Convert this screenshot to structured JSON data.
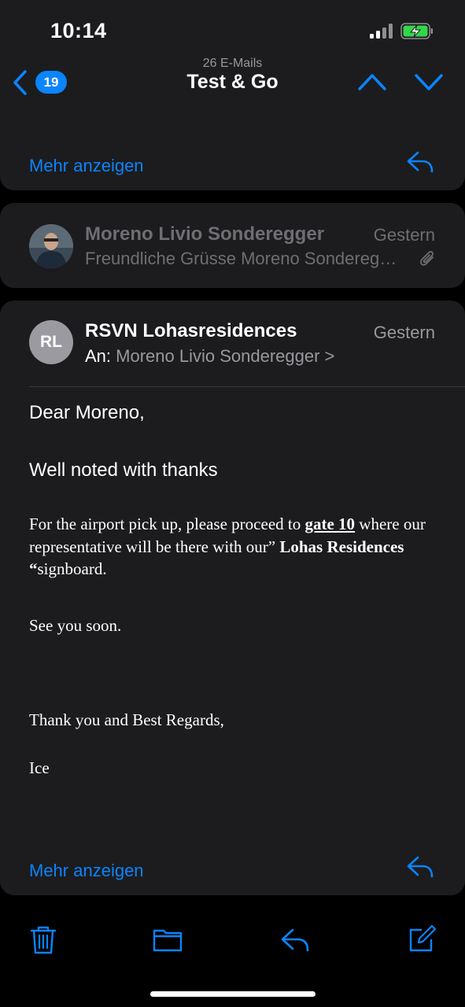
{
  "status_bar": {
    "time": "10:14",
    "signal_bars": 2,
    "signal_total": 4,
    "battery": "charging"
  },
  "nav": {
    "back_count": "19",
    "subtitle": "26 E-Mails",
    "title": "Test & Go",
    "icons": [
      "chevron-left-icon",
      "chevron-up-icon",
      "chevron-down-icon"
    ]
  },
  "first_message": {
    "show_more": "Mehr anzeigen"
  },
  "second_message": {
    "sender": "Moreno Livio Sonderegger",
    "date": "Gestern",
    "preview": "Freundliche Grüsse Moreno Sonderegger",
    "has_attachment": true
  },
  "open_message": {
    "avatar_initials": "RL",
    "sender": "RSVN Lohasresidences",
    "date": "Gestern",
    "to_label": "An:",
    "to_name": "Moreno Livio Sonderegger",
    "to_chevron": ">",
    "greeting": "Dear Moreno,",
    "line1": "Well noted with thanks",
    "para_a": "For the airport pick up, please proceed to ",
    "para_gate": "gate 10",
    "para_b": " where our representative will be there with our” ",
    "para_bold": "Lohas Residences “",
    "para_c": "signboard.",
    "line_soon": "See you soon.",
    "closing": "Thank you and Best Regards,",
    "signature": "Ice",
    "show_more": "Mehr anzeigen"
  },
  "toolbar": {
    "icons": [
      "trash-icon",
      "folder-icon",
      "reply-icon",
      "compose-icon"
    ]
  },
  "colors": {
    "accent": "#0a84ff",
    "card": "#1c1c1e",
    "background": "#000000",
    "dim_text": "#6e6e73"
  }
}
